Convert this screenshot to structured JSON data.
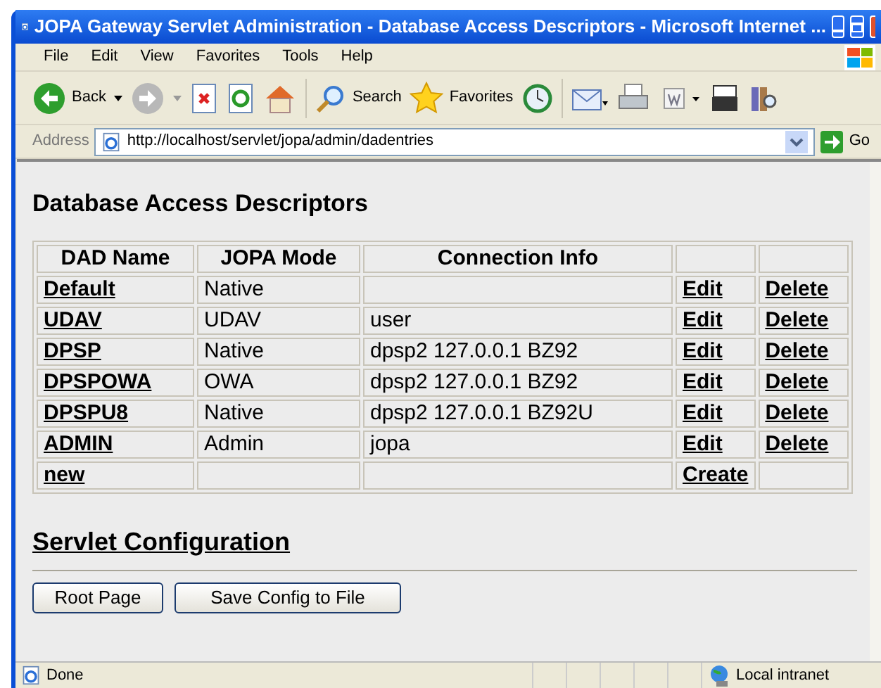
{
  "window": {
    "title": "JOPA Gateway Servlet Administration - Database Access Descriptors - Microsoft Internet ..."
  },
  "menu": [
    "File",
    "Edit",
    "View",
    "Favorites",
    "Tools",
    "Help"
  ],
  "toolbar": {
    "back": "Back",
    "search": "Search",
    "favorites": "Favorites"
  },
  "address": {
    "label": "Address",
    "value": "http://localhost/servlet/jopa/admin/dadentries",
    "go": "Go"
  },
  "page": {
    "heading": "Database Access Descriptors",
    "table": {
      "columns": [
        "DAD Name",
        "JOPA Mode",
        "Connection Info"
      ],
      "rows": [
        {
          "name": "Default",
          "mode": "Native",
          "actions": [
            "Edit",
            "Delete"
          ]
        },
        {
          "name": "UDAV",
          "mode": "UDAV",
          "info": "user",
          "actions": [
            "Edit",
            "Delete"
          ]
        },
        {
          "name": "DPSP",
          "mode": "Native",
          "info": "dpsp2 127.0.0.1 BZ92",
          "actions": [
            "Edit",
            "Delete"
          ]
        },
        {
          "name": "DPSPOWA",
          "mode": "OWA",
          "info": "dpsp2 127.0.0.1 BZ92",
          "actions": [
            "Edit",
            "Delete"
          ]
        },
        {
          "name": "DPSPU8",
          "mode": "Native",
          "info": "dpsp2 127.0.0.1 BZ92U",
          "actions": [
            "Edit",
            "Delete"
          ]
        },
        {
          "name": "ADMIN",
          "mode": "Admin",
          "info": "jopa",
          "actions": [
            "Edit",
            "Delete"
          ]
        },
        {
          "name": "new",
          "actions": [
            "Create"
          ]
        }
      ]
    },
    "section": "Servlet Configuration",
    "buttons": [
      "Root Page",
      "Save Config to File"
    ]
  },
  "status_bar": {
    "text": "Done",
    "zone": "Local intranet"
  }
}
